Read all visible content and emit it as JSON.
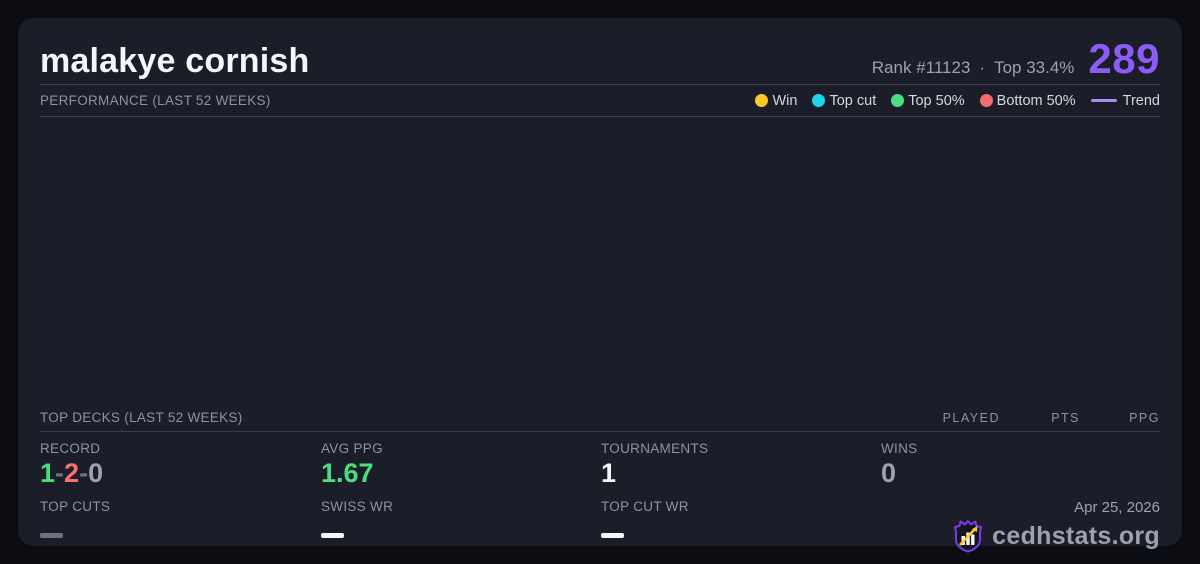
{
  "colors": {
    "page_bg": "#0c0d12",
    "card_bg": "#1b1e28",
    "divider": "#373d4d",
    "accent_purple": "#8b5cf6",
    "win_yellow": "#fbc826",
    "top_cut_cyan": "#22d3ee",
    "top50_green": "#4ade80",
    "bottom50_red": "#f26d6d",
    "trend_purple": "#a78bfa",
    "text_white": "#f5f6fa",
    "text_gray": "#8b93a7"
  },
  "header": {
    "player_name": "malakye cornish",
    "rank_label": "Rank #11123",
    "separator": "·",
    "top_percent_label": "Top 33.4%",
    "points": "289"
  },
  "performance": {
    "title": "PERFORMANCE (LAST 52 WEEKS)",
    "legend": [
      {
        "label": "Win",
        "swatch": "dot",
        "color": "#fbc826"
      },
      {
        "label": "Top cut",
        "swatch": "dot",
        "color": "#22d3ee"
      },
      {
        "label": "Top 50%",
        "swatch": "dot",
        "color": "#4ade80"
      },
      {
        "label": "Bottom 50%",
        "swatch": "dot",
        "color": "#f26d6d"
      },
      {
        "label": "Trend",
        "swatch": "line",
        "color": "#a78bfa"
      }
    ]
  },
  "top_decks": {
    "title": "TOP DECKS (LAST 52 WEEKS)",
    "columns": [
      "PLAYED",
      "PTS",
      "PPG"
    ],
    "rows": []
  },
  "stats": {
    "record": {
      "label": "RECORD",
      "wins": "1",
      "losses": "2",
      "draws": "0",
      "separator": "-"
    },
    "avg_ppg": {
      "label": "AVG PPG",
      "value": "1.67"
    },
    "tournaments": {
      "label": "TOURNAMENTS",
      "value": "1"
    },
    "wins": {
      "label": "WINS",
      "value": "0"
    },
    "top_cuts": {
      "label": "TOP CUTS",
      "value": "—"
    },
    "swiss_wr": {
      "label": "SWISS WR",
      "value": "—"
    },
    "top_cut_wr": {
      "label": "TOP CUT WR",
      "value": "—"
    }
  },
  "footer": {
    "date": "Apr 25, 2026",
    "site_name": "cedhstats.org",
    "logo": "cedhstats-shield-logo"
  }
}
